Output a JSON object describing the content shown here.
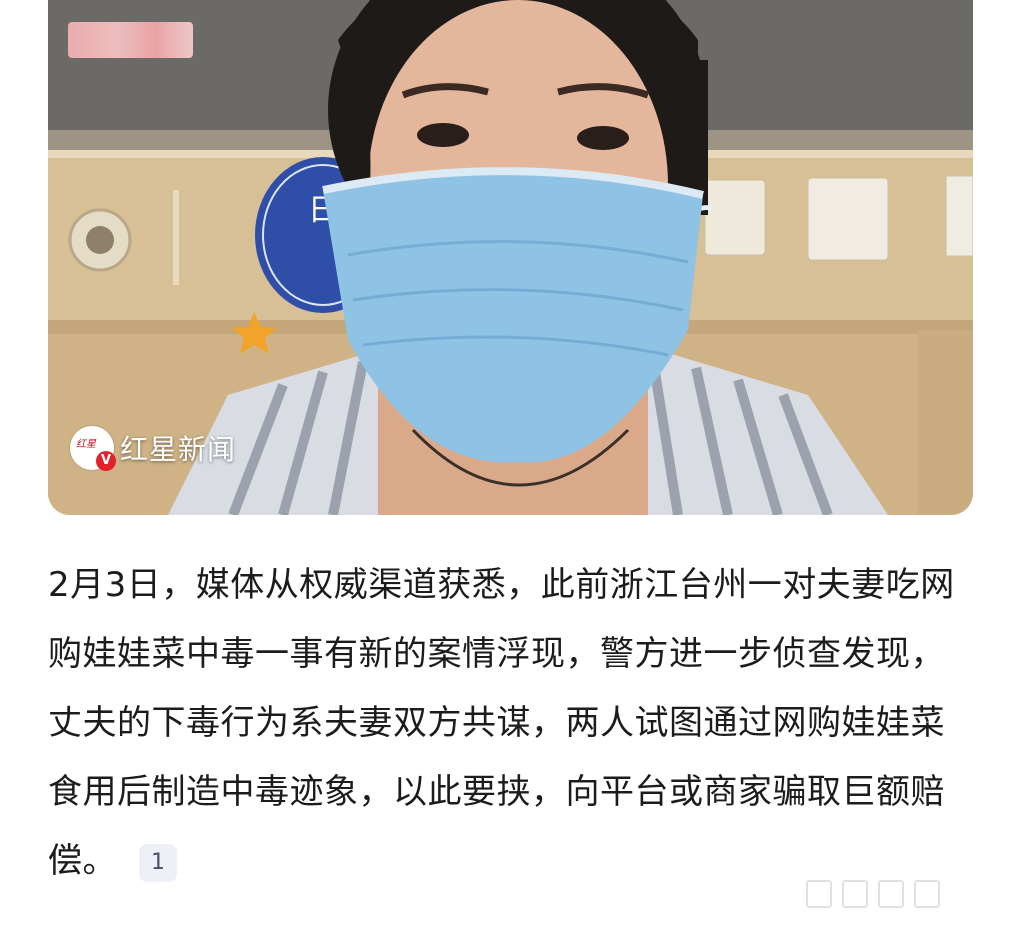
{
  "image": {
    "watermark_text": "红星新闻",
    "watermark_logo_text": "红星",
    "watermark_badge": "V"
  },
  "article": {
    "body": "2月3日，媒体从权威渠道获悉，此前浙江台州一对夫妻吃网购娃娃菜中毒一事有新的案情浮现，警方进一步侦查发现，丈夫的下毒行为系夫妻双方共谋，两人试图通过网购娃娃菜食用后制造中毒迹象，以此要挟，向平台或商家骗取巨额赔偿。",
    "citation": "1"
  },
  "colors": {
    "text": "#1c1c1c",
    "citation_bg": "#eef0f8",
    "mask": "#8fc3e6",
    "brand_red": "#e0222a"
  }
}
